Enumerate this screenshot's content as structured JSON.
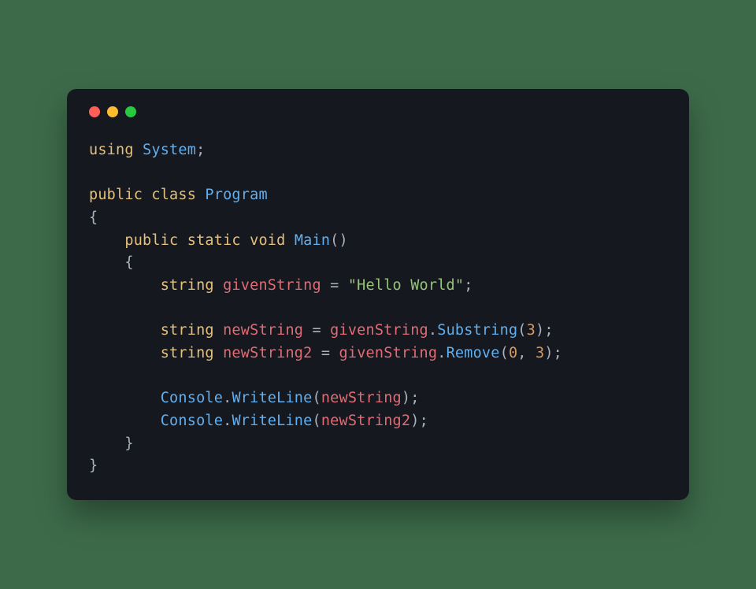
{
  "window": {
    "dots": [
      "red",
      "yellow",
      "green"
    ]
  },
  "code": {
    "t01": "using",
    "t02": "System",
    "t03": ";",
    "t04": "public",
    "t05": "class",
    "t06": "Program",
    "t07": "{",
    "t08": "public",
    "t09": "static",
    "t10": "void",
    "t11": "Main",
    "t12": "(",
    "t13": ")",
    "t14": "{",
    "t15": "string",
    "t16": "givenString",
    "t17": "=",
    "t18": "\"Hello World\"",
    "t19": ";",
    "t20": "string",
    "t21": "newString",
    "t22": "=",
    "t23": "givenString",
    "t24": ".",
    "t25": "Substring",
    "t26": "(",
    "t27": "3",
    "t28": ")",
    "t29": ";",
    "t30": "string",
    "t31": "newString2",
    "t32": "=",
    "t33": "givenString",
    "t34": ".",
    "t35": "Remove",
    "t36": "(",
    "t37": "0",
    "t38": ",",
    "t39": "3",
    "t40": ")",
    "t41": ";",
    "t42": "Console",
    "t43": ".",
    "t44": "WriteLine",
    "t45": "(",
    "t46": "newString",
    "t47": ")",
    "t48": ";",
    "t49": "Console",
    "t50": ".",
    "t51": "WriteLine",
    "t52": "(",
    "t53": "newString2",
    "t54": ")",
    "t55": ";",
    "t56": "}",
    "t57": "}"
  }
}
